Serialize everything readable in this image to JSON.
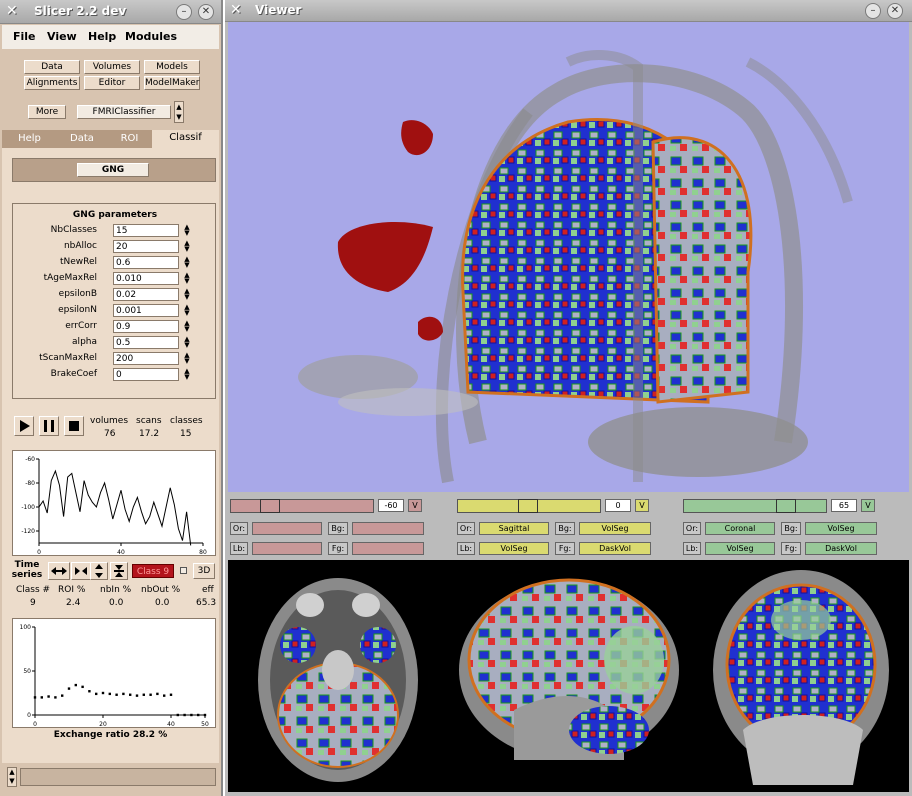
{
  "slicer": {
    "title": "Slicer 2.2 dev",
    "menus": [
      "File",
      "View",
      "Help",
      "Modules"
    ],
    "module_buttons": [
      "Data",
      "Volumes",
      "Models",
      "Alignments",
      "Editor",
      "ModelMaker"
    ],
    "more_label": "More",
    "module_select": "FMRIClassifier",
    "tabs": [
      "Help",
      "Data",
      "ROI",
      "Classif"
    ],
    "gng_button": "GNG",
    "params_title": "GNG parameters",
    "params": [
      {
        "label": "NbClasses",
        "value": "15"
      },
      {
        "label": "nbAlloc",
        "value": "20"
      },
      {
        "label": "tNewRel",
        "value": "0.6"
      },
      {
        "label": "tAgeMaxRel",
        "value": "0.010"
      },
      {
        "label": "epsilonB",
        "value": "0.02"
      },
      {
        "label": "epsilonN",
        "value": "0.001"
      },
      {
        "label": "errCorr",
        "value": "0.9"
      },
      {
        "label": "alpha",
        "value": "0.5"
      },
      {
        "label": "tScanMaxRel",
        "value": "200"
      },
      {
        "label": "BrakeCoef",
        "value": "0"
      }
    ],
    "stats_headers": [
      "volumes",
      "scans",
      "classes"
    ],
    "stats_values": [
      "76",
      "17.2",
      "15"
    ],
    "time_series_label": "Time series",
    "class_button": "Class 9",
    "btn_3d": "3D",
    "table_headers": [
      "Class #",
      "ROI %",
      "nbIn %",
      "nbOut %",
      "eff"
    ],
    "table_values": [
      "9",
      "2.4",
      "0.0",
      "0.0",
      "65.3"
    ],
    "exchange_label": "Exchange ratio 28.2 %"
  },
  "viewer": {
    "title": "Viewer",
    "red": {
      "value": "-60",
      "v_label": "V",
      "or_label": "Or:",
      "bg_label": "Bg:",
      "lb_label": "Lb:",
      "fg_label": "Fg:",
      "bg_value": "",
      "or_value": "",
      "lb_value": "",
      "fg_value": ""
    },
    "yellow": {
      "value": "0",
      "v_label": "V",
      "or_label": "Or:",
      "or_value": "Sagittal",
      "bg_label": "Bg:",
      "bg_value": "VolSeg",
      "lb_label": "Lb:",
      "lb_value": "VolSeg",
      "fg_label": "Fg:",
      "fg_value": "DaskVol"
    },
    "green": {
      "value": "65",
      "v_label": "V",
      "or_label": "Or:",
      "or_value": "Coronal",
      "bg_label": "Bg:",
      "bg_value": "VolSeg",
      "lb_label": "Lb:",
      "lb_value": "VolSeg",
      "fg_label": "Fg:",
      "fg_value": "DaskVol"
    }
  },
  "chart_data": [
    {
      "type": "line",
      "x": [
        0,
        2,
        4,
        6,
        8,
        10,
        12,
        14,
        16,
        18,
        20,
        22,
        24,
        26,
        28,
        30,
        32,
        34,
        36,
        38,
        40,
        42,
        44,
        46,
        48,
        50,
        52,
        54,
        56,
        58,
        60,
        62,
        64,
        66,
        68,
        70,
        72,
        74
      ],
      "values": [
        -100,
        -95,
        -105,
        -78,
        -70,
        -82,
        -108,
        -75,
        -72,
        -88,
        -104,
        -78,
        -90,
        -96,
        -100,
        -88,
        -80,
        -94,
        -110,
        -98,
        -86,
        -102,
        -112,
        -100,
        -92,
        -104,
        -114,
        -108,
        -96,
        -106,
        -116,
        -100,
        -84,
        -98,
        -118,
        -128,
        -104,
        -132
      ],
      "xlim": [
        0,
        80
      ],
      "ylim": [
        -130,
        -60
      ],
      "x_ticks": [
        "0",
        "40",
        "80"
      ],
      "y_ticks": [
        "-60",
        "-80",
        "-100",
        "-120"
      ]
    },
    {
      "type": "scatter",
      "x": [
        0,
        2,
        4,
        6,
        8,
        10,
        12,
        14,
        16,
        18,
        20,
        22,
        24,
        26,
        28,
        30,
        32,
        34,
        36,
        38,
        40,
        42,
        44,
        46,
        48,
        50
      ],
      "values": [
        20,
        20,
        21,
        20,
        22,
        30,
        34,
        32,
        27,
        24,
        25,
        24,
        23,
        24,
        23,
        22,
        23,
        23,
        24,
        22,
        23,
        0,
        0,
        0,
        0,
        0
      ],
      "xlim": [
        0,
        50
      ],
      "ylim": [
        0,
        100
      ],
      "x_ticks": [
        "0",
        "20",
        "40",
        "50"
      ],
      "y_ticks": [
        "100",
        "50",
        "0"
      ]
    }
  ]
}
